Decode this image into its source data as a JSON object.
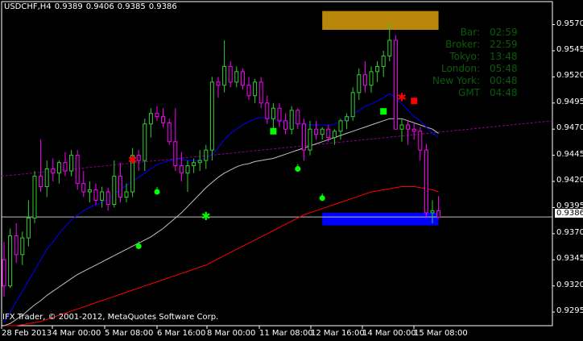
{
  "window": {
    "symbol_timeframe": "USDCHF,H4",
    "ohlc": [
      "0.9389",
      "0.9406",
      "0.9385",
      "0.9386"
    ]
  },
  "info_panel": [
    {
      "label": "Bar:",
      "value": "02:59"
    },
    {
      "label": "Broker:",
      "value": "22:59"
    },
    {
      "label": "Tokyo:",
      "value": "13:48"
    },
    {
      "label": "London:",
      "value": "05:48"
    },
    {
      "label": "New York:",
      "value": "00:48"
    },
    {
      "label": "GMT",
      "value": "04:48"
    }
  ],
  "price_axis": [
    "0.9570",
    "0.9545",
    "0.9520",
    "0.9495",
    "0.9470",
    "0.9445",
    "0.9420",
    "0.9395",
    "0.9370",
    "0.9345",
    "0.9320",
    "0.9295"
  ],
  "current_price": "0.9386",
  "time_axis": [
    "28 Feb 2013",
    "4 Mar 00:00",
    "5 Mar 08:00",
    "6 Mar 16:00",
    "8 Mar 00:00",
    "11 Mar 08:00",
    "12 Mar 16:00",
    "14 Mar 00:00",
    "15 Mar 08:00"
  ],
  "copyright": "IFX Trader, © 2001-2012, MetaQuotes Software Corp.",
  "colors": {
    "bull_candle": "#32cd32",
    "bear_candle": "#ff00ff",
    "ma_blue": "#0000ff",
    "ma_white": "#c0c0c0",
    "ma_red": "#ff0000",
    "trend_line": "#8b008b",
    "supply_zone": "#b8860b",
    "demand_zone": "#0000ff",
    "info_text": "#0a5c0a"
  },
  "chart_data": {
    "type": "candlestick",
    "symbol": "USDCHF",
    "timeframe": "H4",
    "ylim": [
      0.9282,
      0.9592
    ],
    "grid": false,
    "candles": [
      [
        0.9345,
        0.9362,
        0.931,
        0.932
      ],
      [
        0.932,
        0.9375,
        0.9318,
        0.9368
      ],
      [
        0.9368,
        0.938,
        0.9342,
        0.935
      ],
      [
        0.935,
        0.9372,
        0.934,
        0.9366
      ],
      [
        0.9366,
        0.9402,
        0.9358,
        0.9385
      ],
      [
        0.9385,
        0.943,
        0.938,
        0.9425
      ],
      [
        0.9425,
        0.946,
        0.941,
        0.9415
      ],
      [
        0.9415,
        0.944,
        0.9405,
        0.9432
      ],
      [
        0.9432,
        0.9442,
        0.942,
        0.9428
      ],
      [
        0.9428,
        0.944,
        0.9418,
        0.9438
      ],
      [
        0.9438,
        0.9448,
        0.9425,
        0.943
      ],
      [
        0.943,
        0.945,
        0.9425,
        0.9445
      ],
      [
        0.9445,
        0.945,
        0.9412,
        0.9418
      ],
      [
        0.9418,
        0.943,
        0.9405,
        0.941
      ],
      [
        0.941,
        0.942,
        0.94,
        0.9412
      ],
      [
        0.9412,
        0.9418,
        0.9398,
        0.9402
      ],
      [
        0.9402,
        0.9415,
        0.9395,
        0.941
      ],
      [
        0.941,
        0.9414,
        0.9392,
        0.9398
      ],
      [
        0.9398,
        0.944,
        0.9395,
        0.9425
      ],
      [
        0.9425,
        0.9438,
        0.94,
        0.9405
      ],
      [
        0.9405,
        0.9418,
        0.94,
        0.941
      ],
      [
        0.941,
        0.9452,
        0.9405,
        0.9445
      ],
      [
        0.9445,
        0.945,
        0.943,
        0.944
      ],
      [
        0.944,
        0.948,
        0.943,
        0.9475
      ],
      [
        0.9475,
        0.949,
        0.9462,
        0.9485
      ],
      [
        0.9485,
        0.9492,
        0.9478,
        0.9482
      ],
      [
        0.9482,
        0.949,
        0.9472,
        0.9476
      ],
      [
        0.9476,
        0.948,
        0.9455,
        0.9458
      ],
      [
        0.9458,
        0.949,
        0.943,
        0.9435
      ],
      [
        0.9435,
        0.9448,
        0.942,
        0.9428
      ],
      [
        0.9428,
        0.944,
        0.941,
        0.9435
      ],
      [
        0.9435,
        0.9442,
        0.9428,
        0.9438
      ],
      [
        0.9438,
        0.945,
        0.943,
        0.944
      ],
      [
        0.944,
        0.9455,
        0.9432,
        0.945
      ],
      [
        0.945,
        0.952,
        0.944,
        0.9515
      ],
      [
        0.9515,
        0.952,
        0.95,
        0.9512
      ],
      [
        0.9512,
        0.9555,
        0.9505,
        0.953
      ],
      [
        0.953,
        0.9535,
        0.951,
        0.9515
      ],
      [
        0.9515,
        0.953,
        0.951,
        0.9525
      ],
      [
        0.9525,
        0.9528,
        0.9508,
        0.9512
      ],
      [
        0.9512,
        0.952,
        0.9498,
        0.9502
      ],
      [
        0.9502,
        0.9518,
        0.9495,
        0.9515
      ],
      [
        0.9515,
        0.952,
        0.949,
        0.9495
      ],
      [
        0.9495,
        0.9502,
        0.9475,
        0.948
      ],
      [
        0.948,
        0.9495,
        0.947,
        0.949
      ],
      [
        0.949,
        0.9495,
        0.9472,
        0.9478
      ],
      [
        0.9478,
        0.9485,
        0.9465,
        0.947
      ],
      [
        0.947,
        0.9492,
        0.9465,
        0.9488
      ],
      [
        0.9488,
        0.949,
        0.947,
        0.9475
      ],
      [
        0.9475,
        0.948,
        0.944,
        0.945
      ],
      [
        0.945,
        0.9478,
        0.9445,
        0.947
      ],
      [
        0.947,
        0.9478,
        0.946,
        0.9465
      ],
      [
        0.9465,
        0.9472,
        0.946,
        0.947
      ],
      [
        0.947,
        0.9474,
        0.9458,
        0.9462
      ],
      [
        0.9462,
        0.947,
        0.9455,
        0.9468
      ],
      [
        0.9468,
        0.948,
        0.946,
        0.9478
      ],
      [
        0.9478,
        0.9485,
        0.947,
        0.9482
      ],
      [
        0.9482,
        0.951,
        0.9478,
        0.9505
      ],
      [
        0.9505,
        0.9528,
        0.9498,
        0.9522
      ],
      [
        0.9522,
        0.9535,
        0.9505,
        0.9512
      ],
      [
        0.9512,
        0.953,
        0.9505,
        0.9525
      ],
      [
        0.9525,
        0.9535,
        0.9515,
        0.953
      ],
      [
        0.953,
        0.9545,
        0.952,
        0.954
      ],
      [
        0.954,
        0.9572,
        0.9535,
        0.9555
      ],
      [
        0.9555,
        0.956,
        0.948,
        0.947
      ],
      [
        0.947,
        0.948,
        0.9458,
        0.9474
      ],
      [
        0.9474,
        0.9478,
        0.9455,
        0.947
      ],
      [
        0.947,
        0.9476,
        0.946,
        0.9468
      ],
      [
        0.9468,
        0.9472,
        0.944,
        0.945
      ],
      [
        0.945,
        0.9456,
        0.9385,
        0.939
      ],
      [
        0.939,
        0.9402,
        0.938,
        0.9392
      ],
      [
        0.9392,
        0.9406,
        0.9385,
        0.9386
      ]
    ],
    "ma_blue": [
      0.9285,
      0.9295,
      0.9305,
      0.9315,
      0.9325,
      0.9335,
      0.9345,
      0.9355,
      0.9362,
      0.937,
      0.9377,
      0.9383,
      0.9388,
      0.9392,
      0.9395,
      0.9398,
      0.94,
      0.9403,
      0.9408,
      0.9412,
      0.9416,
      0.942,
      0.9424,
      0.9428,
      0.9432,
      0.9436,
      0.9438,
      0.944,
      0.9441,
      0.9441,
      0.944,
      0.944,
      0.944,
      0.9442,
      0.9446,
      0.9452,
      0.946,
      0.9466,
      0.947,
      0.9474,
      0.9477,
      0.948,
      0.9481,
      0.9481,
      0.948,
      0.9478,
      0.9476,
      0.9476,
      0.9476,
      0.9474,
      0.9474,
      0.9474,
      0.9474,
      0.9474,
      0.9475,
      0.9477,
      0.948,
      0.9484,
      0.9488,
      0.9492,
      0.9494,
      0.9497,
      0.95,
      0.9504,
      0.95,
      0.9494,
      0.9488,
      0.9482,
      0.9478,
      0.9472,
      0.9466,
      0.9462
    ],
    "ma_white": [
      0.9282,
      0.9284,
      0.9288,
      0.9292,
      0.9297,
      0.9302,
      0.9306,
      0.9311,
      0.9315,
      0.9319,
      0.9323,
      0.9327,
      0.9331,
      0.9334,
      0.9337,
      0.934,
      0.9343,
      0.9346,
      0.9349,
      0.9352,
      0.9355,
      0.9358,
      0.9361,
      0.9364,
      0.9367,
      0.9371,
      0.9375,
      0.938,
      0.9385,
      0.939,
      0.9396,
      0.9402,
      0.9408,
      0.9414,
      0.9419,
      0.9424,
      0.9428,
      0.9431,
      0.9434,
      0.9436,
      0.9437,
      0.9439,
      0.944,
      0.9441,
      0.9442,
      0.9444,
      0.9446,
      0.9448,
      0.945,
      0.9452,
      0.9454,
      0.9456,
      0.9458,
      0.946,
      0.9462,
      0.9464,
      0.9466,
      0.9468,
      0.947,
      0.9472,
      0.9474,
      0.9476,
      0.9478,
      0.948,
      0.948,
      0.948,
      0.9478,
      0.9476,
      0.9474,
      0.9472,
      0.947,
      0.9466
    ],
    "ma_red": [
      0.9282,
      0.9282,
      0.9282,
      0.9283,
      0.9284,
      0.9285,
      0.9286,
      0.9288,
      0.929,
      0.9292,
      0.9294,
      0.9296,
      0.9298,
      0.93,
      0.9302,
      0.9304,
      0.9306,
      0.9308,
      0.931,
      0.9312,
      0.9314,
      0.9316,
      0.9318,
      0.932,
      0.9322,
      0.9324,
      0.9326,
      0.9328,
      0.933,
      0.9332,
      0.9334,
      0.9336,
      0.9338,
      0.934,
      0.9343,
      0.9346,
      0.9349,
      0.9352,
      0.9355,
      0.9358,
      0.9361,
      0.9364,
      0.9367,
      0.937,
      0.9373,
      0.9376,
      0.9379,
      0.9382,
      0.9385,
      0.9388,
      0.939,
      0.9392,
      0.9394,
      0.9396,
      0.9398,
      0.94,
      0.9402,
      0.9404,
      0.9406,
      0.9408,
      0.941,
      0.9411,
      0.9412,
      0.9413,
      0.9414,
      0.9415,
      0.9415,
      0.9415,
      0.9414,
      0.9413,
      0.9412,
      0.941
    ],
    "trend_line": [
      0.9425,
      0.9478
    ],
    "supply_zone": {
      "price_range": [
        0.9565,
        0.9583
      ],
      "bar_range": [
        52,
        71
      ]
    },
    "demand_zone": {
      "price_range": [
        0.9378,
        0.939
      ],
      "bar_range": [
        52,
        71
      ]
    },
    "markers": [
      {
        "kind": "red-star",
        "bar": 21,
        "price": 0.944
      },
      {
        "kind": "green-circle",
        "bar": 25,
        "price": 0.941
      },
      {
        "kind": "green-star",
        "bar": 33,
        "price": 0.9386
      },
      {
        "kind": "green-circle",
        "bar": 22,
        "price": 0.9358
      },
      {
        "kind": "green-square",
        "bar": 44,
        "price": 0.9468
      },
      {
        "kind": "green-circle",
        "bar": 48,
        "price": 0.9432
      },
      {
        "kind": "green-circle",
        "bar": 52,
        "price": 0.9404
      },
      {
        "kind": "green-square",
        "bar": 62,
        "price": 0.9487
      },
      {
        "kind": "red-star",
        "bar": 65,
        "price": 0.95
      },
      {
        "kind": "red-square",
        "bar": 67,
        "price": 0.9497
      }
    ]
  }
}
